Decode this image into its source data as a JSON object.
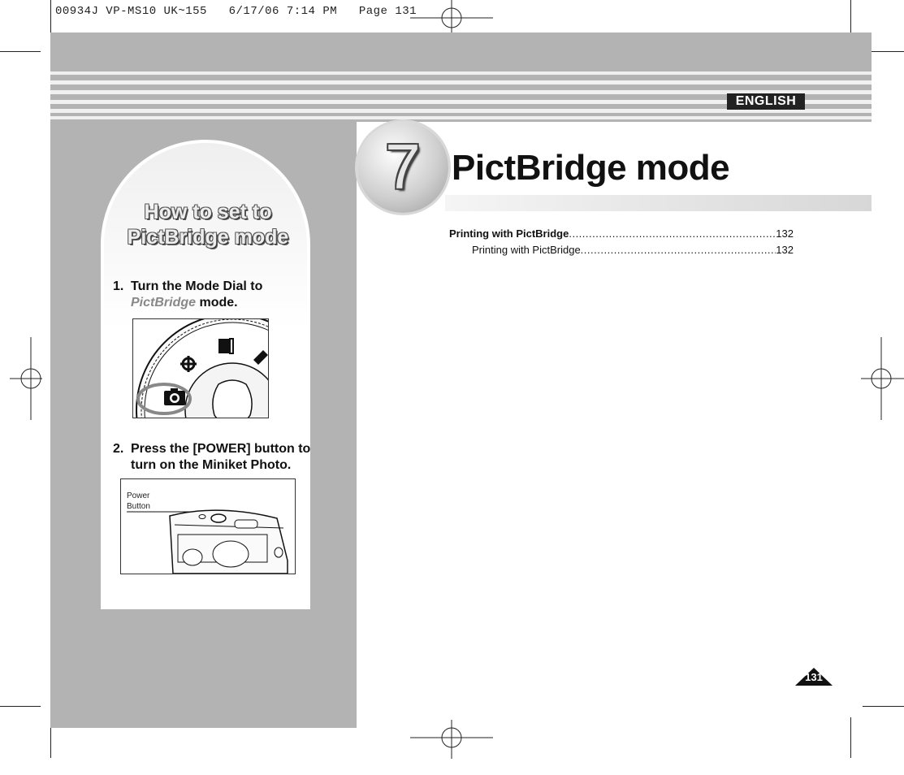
{
  "print_slug": "00934J VP-MS10 UK~155   6/17/06 7:14 PM   Page 131",
  "language_label": "ENGLISH",
  "chapter": {
    "number": "7",
    "title": "PictBridge mode"
  },
  "sidebar": {
    "title_line1": "How to set to",
    "title_line2": "PictBridge mode",
    "step1": {
      "num": "1.",
      "text_a": "Turn the Mode Dial to",
      "text_b_emph": "PictBridge",
      "text_b_rest": " mode."
    },
    "step2": {
      "num": "2.",
      "text_a": "Press the [POWER] button to",
      "text_b": "turn on the Miniket Photo."
    },
    "power_label_line1": "Power",
    "power_label_line2": "Button"
  },
  "toc": [
    {
      "label": "Printing with PictBridge",
      "page": "132",
      "bold": true
    },
    {
      "label": "Printing with PictBridge",
      "page": "132",
      "bold": false
    }
  ],
  "page_number": "131"
}
